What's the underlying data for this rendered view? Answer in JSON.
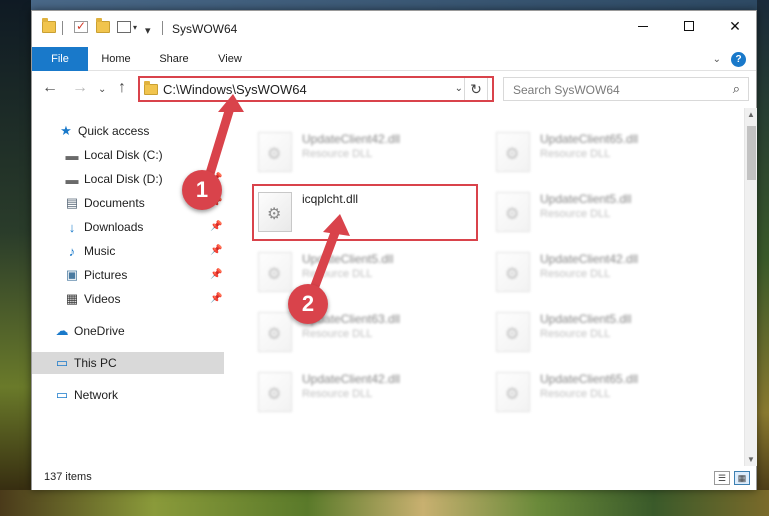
{
  "window": {
    "title": "SysWOW64",
    "minimize_glyph": "",
    "close_glyph": "✕"
  },
  "ribbon": {
    "tabs": [
      "File",
      "Home",
      "Share",
      "View"
    ],
    "expand_glyph": "⌄",
    "help_glyph": "?"
  },
  "navigation": {
    "back_glyph": "←",
    "forward_glyph": "→",
    "recent_glyph": "⌄",
    "up_glyph": "↑",
    "address_path": "C:\\Windows\\SysWOW64",
    "address_dropdown_glyph": "⌄",
    "refresh_glyph": "↻",
    "search_placeholder": "Search SysWOW64",
    "search_icon_glyph": "⌕"
  },
  "sidebar": {
    "items": [
      {
        "label": "Quick access",
        "icon": "star-icon",
        "glyph": "★",
        "color": "#1979ca",
        "pinned": false
      },
      {
        "label": "Local Disk (C:)",
        "icon": "drive-icon",
        "glyph": "▬",
        "color": "#6a6a6a",
        "pinned": false
      },
      {
        "label": "Local Disk (D:)",
        "icon": "drive-icon",
        "glyph": "▬",
        "color": "#6a6a6a",
        "pinned": true
      },
      {
        "label": "Documents",
        "icon": "documents-icon",
        "glyph": "▤",
        "color": "#5a6a7a",
        "pinned": true
      },
      {
        "label": "Downloads",
        "icon": "download-icon",
        "glyph": "↓",
        "color": "#1979ca",
        "pinned": true
      },
      {
        "label": "Music",
        "icon": "music-icon",
        "glyph": "♪",
        "color": "#1979ca",
        "pinned": true
      },
      {
        "label": "Pictures",
        "icon": "pictures-icon",
        "glyph": "▣",
        "color": "#4a7aa0",
        "pinned": true
      },
      {
        "label": "Videos",
        "icon": "videos-icon",
        "glyph": "▦",
        "color": "#3a3a3a",
        "pinned": true
      },
      {
        "label": "OneDrive",
        "icon": "onedrive-icon",
        "glyph": "☁",
        "color": "#1979ca",
        "pinned": false
      },
      {
        "label": "This PC",
        "icon": "computer-icon",
        "glyph": "▭",
        "color": "#1979ca",
        "pinned": false,
        "selected": true
      },
      {
        "label": "Network",
        "icon": "network-icon",
        "glyph": "▭",
        "color": "#1979ca",
        "pinned": false
      }
    ],
    "pin_glyph": "📌"
  },
  "files": [
    {
      "name": "UpdateClient42.dll",
      "type": "Resource DLL",
      "blurred": true
    },
    {
      "name": "UpdateClient65.dll",
      "type": "Resource DLL",
      "blurred": true
    },
    {
      "name": "icqplcht.dll",
      "type": "",
      "blurred": false
    },
    {
      "name": "UpdateClient5.dll",
      "type": "Resource DLL",
      "blurred": true
    },
    {
      "name": "UpdateClient5.dll",
      "type": "Resource DLL",
      "blurred": true
    },
    {
      "name": "UpdateClient42.dll",
      "type": "Resource DLL",
      "blurred": true
    },
    {
      "name": "UpdateClient63.dll",
      "type": "Resource DLL",
      "blurred": true
    },
    {
      "name": "UpdateClient5.dll",
      "type": "Resource DLL",
      "blurred": true
    },
    {
      "name": "UpdateClient42.dll",
      "type": "Resource DLL",
      "blurred": true
    },
    {
      "name": "UpdateClient65.dll",
      "type": "Resource DLL",
      "blurred": true
    }
  ],
  "status": {
    "item_count": "137 items"
  },
  "annotations": {
    "step1": "1",
    "step2": "2",
    "highlight_color": "#d9434b"
  },
  "colors": {
    "accent": "#1979ca",
    "selection": "#d9d9d9"
  }
}
